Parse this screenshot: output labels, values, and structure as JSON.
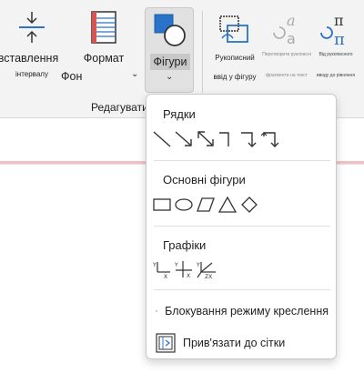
{
  "ribbon": {
    "spacing_button": {
      "line1": "вставлення",
      "line2": "інтервалу"
    },
    "format_bg_button": {
      "line1": "Формат",
      "line2": "Фон"
    },
    "shapes_button": {
      "label": "Фігури"
    },
    "group_label": "Редагувати",
    "ink_to_shape_button": {
      "line1": "Рукописний",
      "line2": "ввід у фігуру"
    },
    "ink_to_text_button": {
      "line1": "Перетворити рукописні",
      "line2": "фрагменти на текст"
    },
    "ink_to_math_button": {
      "line1": "Від рукописного",
      "line2": "вводу до рівняння"
    }
  },
  "menu": {
    "lines_title": "Рядки",
    "basic_shapes_title": "Основні фігури",
    "graphs_title": "Графіки",
    "lock_drawing_label": "Блокування режиму креслення",
    "snap_to_grid_label": "Прив'язати до сітки"
  },
  "icons": {
    "lines": [
      "line-icon",
      "arrow-icon",
      "double-arrow-icon",
      "elbow-connector-icon",
      "elbow-arrow-icon",
      "elbow-double-arrow-icon"
    ],
    "basic_shapes": [
      "rectangle-icon",
      "ellipse-icon",
      "parallelogram-icon",
      "triangle-icon",
      "diamond-icon"
    ],
    "graphs": [
      "xy-graph-icon",
      "xy-axis-graph-icon",
      "xyz-graph-icon"
    ]
  },
  "colors": {
    "accent_blue": "#1a5ea8",
    "shape_fill_blue": "#2a73c8",
    "ribbon_bg": "#f3f3f3",
    "selected_button_bg": "#e1e1e1",
    "page_border_pink": "#f2c1c4"
  }
}
